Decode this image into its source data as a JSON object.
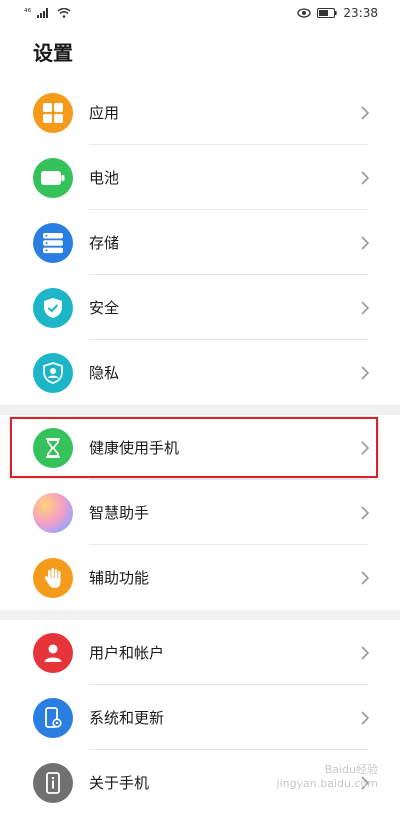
{
  "status_bar": {
    "signal_text": "⁴⁶",
    "time": "23:38"
  },
  "title": "设置",
  "groups": [
    [
      {
        "label": "应用",
        "icon": "apps-icon",
        "color": "#f49b1b"
      },
      {
        "label": "电池",
        "icon": "battery-icon",
        "color": "#35c25a"
      },
      {
        "label": "存储",
        "icon": "storage-icon",
        "color": "#2a7de1"
      },
      {
        "label": "安全",
        "icon": "shield-check-icon",
        "color": "#1cb6c8"
      },
      {
        "label": "隐私",
        "icon": "privacy-icon",
        "color": "#1cb6c8"
      }
    ],
    [
      {
        "label": "健康使用手机",
        "icon": "hourglass-icon",
        "color": "#35c25a"
      },
      {
        "label": "智慧助手",
        "icon": "assistant-icon",
        "color": "#f2a7c5"
      },
      {
        "label": "辅助功能",
        "icon": "hand-icon",
        "color": "#f49b1b"
      }
    ],
    [
      {
        "label": "用户和帐户",
        "icon": "user-icon",
        "color": "#e6343b"
      },
      {
        "label": "系统和更新",
        "icon": "phone-settings-icon",
        "color": "#2a7de1"
      },
      {
        "label": "关于手机",
        "icon": "phone-info-icon",
        "color": "#707070"
      }
    ]
  ],
  "watermark": "Baidu经验\njingyan.baidu.com"
}
